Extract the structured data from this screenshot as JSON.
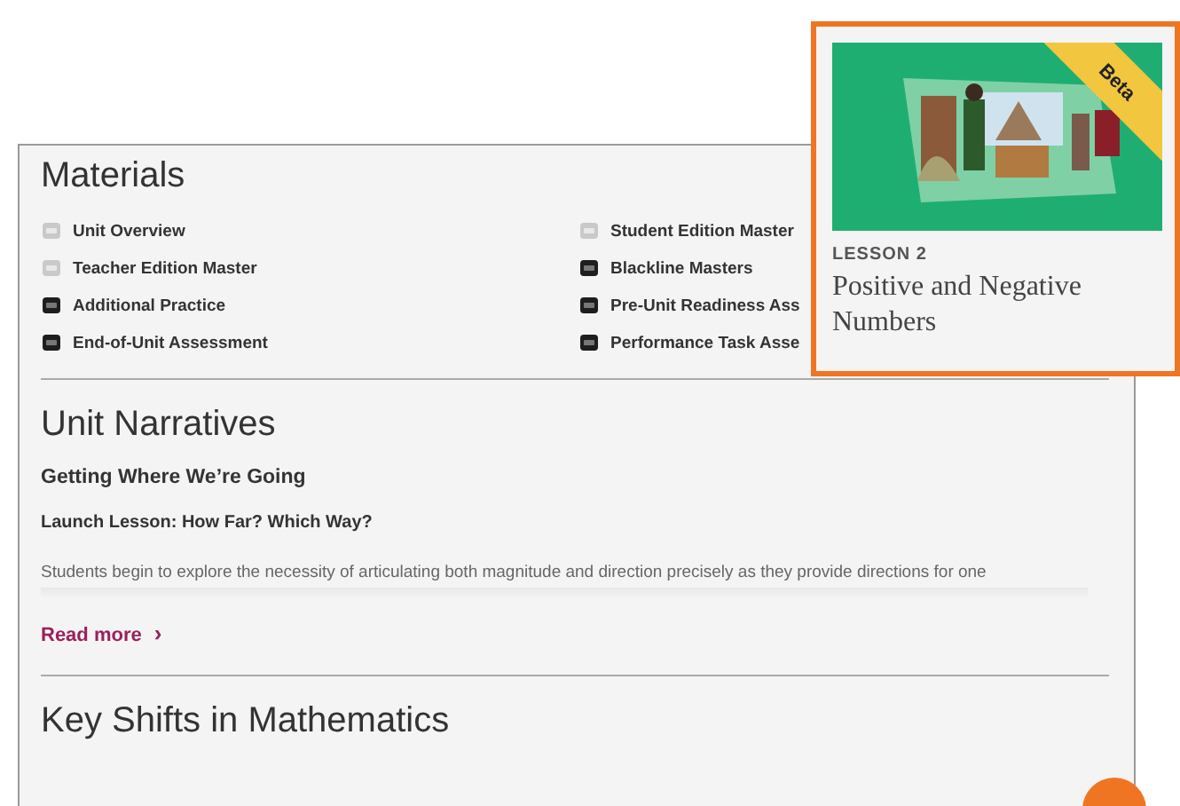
{
  "materials": {
    "title": "Materials",
    "items": [
      {
        "label": "Unit Overview",
        "kind": "pdf"
      },
      {
        "label": "Student Edition Master",
        "kind": "pdf"
      },
      {
        "label": "Teacher Edition Master",
        "kind": "pdf"
      },
      {
        "label": "Blackline Masters",
        "kind": "zip"
      },
      {
        "label": "Additional Practice",
        "kind": "zip"
      },
      {
        "label": "Pre-Unit Readiness Ass",
        "kind": "zip"
      },
      {
        "label": "End-of-Unit Assessment",
        "kind": "zip"
      },
      {
        "label": "Performance Task Asse",
        "kind": "zip"
      }
    ]
  },
  "narratives": {
    "title": "Unit Narratives",
    "subtitle": "Getting Where We’re Going",
    "lesson": "Launch Lesson: How Far? Which Way?",
    "text": "Students begin to explore the necessity of articulating both magnitude and direction precisely as they provide directions for one",
    "link": "Read more",
    "link_icon": "›"
  },
  "next_section": {
    "title": "Key Shifts in Mathematics"
  },
  "lesson_card": {
    "badge": "Beta",
    "eyebrow": "LESSON 2",
    "title": "Positive and Negative Numbers"
  }
}
